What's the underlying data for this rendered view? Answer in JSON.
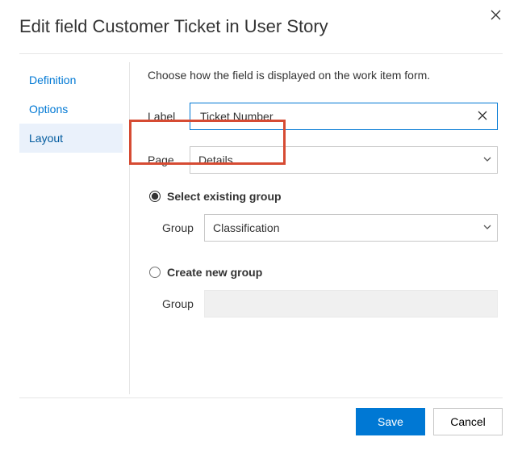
{
  "header": {
    "title": "Edit field Customer Ticket in User Story"
  },
  "sidebar": {
    "items": [
      {
        "label": "Definition"
      },
      {
        "label": "Options"
      },
      {
        "label": "Layout"
      }
    ]
  },
  "content": {
    "instruction": "Choose how the field is displayed on the work item form.",
    "label_field_caption": "Label",
    "label_field_value": "Ticket Number",
    "page_field_caption": "Page",
    "page_field_value": "Details",
    "radio_existing": "Select existing group",
    "group_caption": "Group",
    "group_value": "Classification",
    "radio_new": "Create new group",
    "group2_caption": "Group"
  },
  "footer": {
    "save": "Save",
    "cancel": "Cancel"
  }
}
